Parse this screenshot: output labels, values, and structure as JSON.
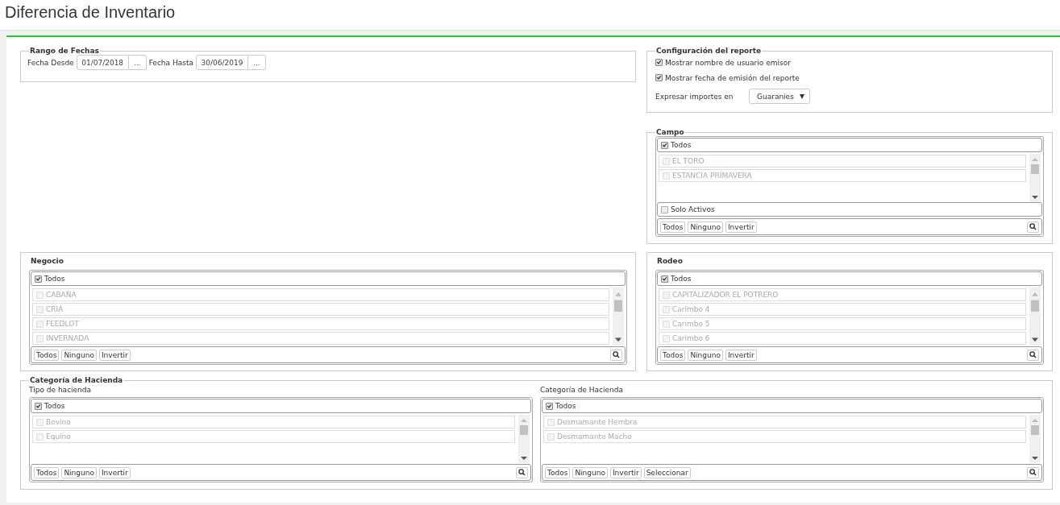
{
  "page_title": "Diferencia de Inventario",
  "date_range": {
    "legend": "Rango de Fechas",
    "fields": [
      {
        "label": "Fecha Desde",
        "value": "01/07/2018",
        "button": "..."
      },
      {
        "label": "Fecha Hasta",
        "value": "30/06/2019",
        "button": "..."
      }
    ]
  },
  "report_config": {
    "legend": "Configuración del reporte",
    "options": [
      {
        "label": "Mostrar nombre de usuario emisor",
        "checked": true
      },
      {
        "label": "Mostrar fecha de emisión del reporte",
        "checked": true
      }
    ],
    "currency": {
      "label": "Expresar importes en",
      "value": "Guaranies"
    }
  },
  "campo": {
    "kind": "fieldset",
    "title": "Campo",
    "list": {
      "all": {
        "label": "Todos",
        "checked": true
      },
      "items": [
        {
          "label": "EL TORO",
          "checked": false,
          "disabled": true
        },
        {
          "label": "ESTANCIA PRIMAVERA",
          "checked": false,
          "disabled": true
        }
      ],
      "extra_option": {
        "label": "Solo Activos",
        "checked": false
      },
      "buttons": [
        "Todos",
        "Ninguno",
        "Invertir"
      ]
    }
  },
  "negocio": {
    "kind": "heading",
    "title": "Negocio",
    "list": {
      "all": {
        "label": "Todos",
        "checked": true
      },
      "items": [
        {
          "label": "CABAÑA",
          "checked": false,
          "disabled": true
        },
        {
          "label": "CRIA",
          "checked": false,
          "disabled": true
        },
        {
          "label": "FEEDLOT",
          "checked": false,
          "disabled": true
        },
        {
          "label": "INVERNADA",
          "checked": false,
          "disabled": true
        }
      ],
      "buttons": [
        "Todos",
        "Ninguno",
        "Invertir"
      ]
    }
  },
  "rodeo": {
    "kind": "heading",
    "title": "Rodeo",
    "list": {
      "all": {
        "label": "Todos",
        "checked": true
      },
      "items": [
        {
          "label": "CAPITALIZADOR EL POTRERO",
          "checked": false,
          "disabled": true
        },
        {
          "label": "Carimbo 4",
          "checked": false,
          "disabled": true
        },
        {
          "label": "Carimbo 5",
          "checked": false,
          "disabled": true
        },
        {
          "label": "Carimbo 6",
          "checked": false,
          "disabled": true
        }
      ],
      "buttons": [
        "Todos",
        "Ninguno",
        "Invertir"
      ]
    }
  },
  "categoria_hacienda": {
    "legend": "Categoría de Hacienda",
    "lists": [
      {
        "label": "Tipo de hacienda",
        "all": {
          "label": "Todos",
          "checked": true
        },
        "items": [
          {
            "label": "Bovino",
            "checked": false,
            "disabled": true
          },
          {
            "label": "Equino",
            "checked": false,
            "disabled": true
          }
        ],
        "buttons": [
          "Todos",
          "Ninguno",
          "Invertir"
        ]
      },
      {
        "label": "Categoría de Hacienda",
        "all": {
          "label": "Todos",
          "checked": true
        },
        "items": [
          {
            "label": "Desmamante Hembra",
            "checked": false,
            "disabled": true
          },
          {
            "label": "Desmamante Macho",
            "checked": false,
            "disabled": true
          }
        ],
        "buttons": [
          "Todos",
          "Ninguno",
          "Invertir",
          "Seleccionar"
        ]
      }
    ]
  }
}
